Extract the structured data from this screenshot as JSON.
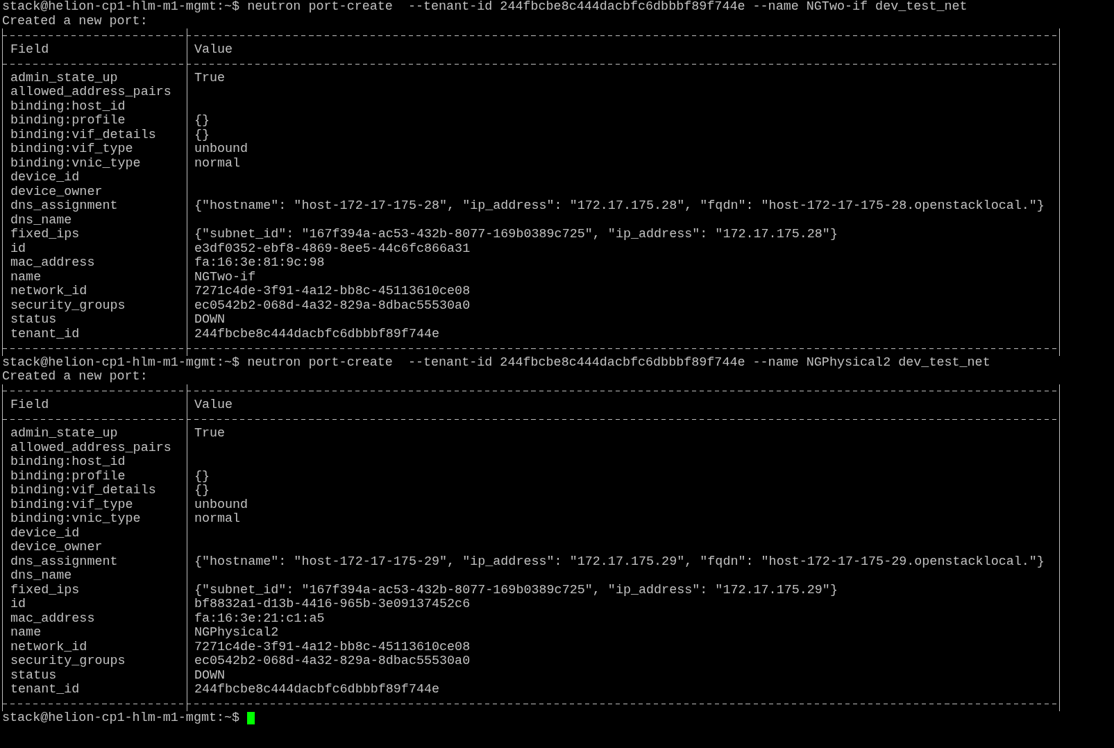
{
  "terminal": {
    "blocks": [
      {
        "prompt": "stack@helion-cp1-hlm-m1-mgmt:~$",
        "command": "neutron port-create  --tenant-id 244fbcbe8c444dacbfc6dbbbf89f744e --name NGTwo-if dev_test_net",
        "output": "Created a new port:",
        "table": {
          "columns": [
            "Field",
            "Value"
          ],
          "rows": [
            {
              "field": "admin_state_up",
              "value": "True"
            },
            {
              "field": "allowed_address_pairs"
            },
            {
              "field": "binding:host_id"
            },
            {
              "field": "binding:profile",
              "value": "{}"
            },
            {
              "field": "binding:vif_details",
              "value": "{}"
            },
            {
              "field": "binding:vif_type",
              "value": "unbound"
            },
            {
              "field": "binding:vnic_type",
              "value": "normal"
            },
            {
              "field": "device_id"
            },
            {
              "field": "device_owner"
            },
            {
              "field": "dns_assignment",
              "value": "{\"hostname\": \"host-172-17-175-28\", \"ip_address\": \"172.17.175.28\", \"fqdn\": \"host-172-17-175-28.openstacklocal.\"}"
            },
            {
              "field": "dns_name"
            },
            {
              "field": "fixed_ips",
              "value": "{\"subnet_id\": \"167f394a-ac53-432b-8077-169b0389c725\", \"ip_address\": \"172.17.175.28\"}"
            },
            {
              "field": "id",
              "value": "e3df0352-ebf8-4869-8ee5-44c6fc866a31"
            },
            {
              "field": "mac_address",
              "value": "fa:16:3e:81:9c:98"
            },
            {
              "field": "name",
              "value": "NGTwo-if"
            },
            {
              "field": "network_id",
              "value": "7271c4de-3f91-4a12-bb8c-45113610ce08"
            },
            {
              "field": "security_groups",
              "value": "ec0542b2-068d-4a32-829a-8dbac55530a0"
            },
            {
              "field": "status",
              "value": "DOWN"
            },
            {
              "field": "tenant_id",
              "value": "244fbcbe8c444dacbfc6dbbbf89f744e"
            }
          ]
        }
      },
      {
        "prompt": "stack@helion-cp1-hlm-m1-mgmt:~$",
        "command": "neutron port-create  --tenant-id 244fbcbe8c444dacbfc6dbbbf89f744e --name NGPhysical2 dev_test_net",
        "output": "Created a new port:",
        "table": {
          "columns": [
            "Field",
            "Value"
          ],
          "rows": [
            {
              "field": "admin_state_up",
              "value": "True"
            },
            {
              "field": "allowed_address_pairs"
            },
            {
              "field": "binding:host_id"
            },
            {
              "field": "binding:profile",
              "value": "{}"
            },
            {
              "field": "binding:vif_details",
              "value": "{}"
            },
            {
              "field": "binding:vif_type",
              "value": "unbound"
            },
            {
              "field": "binding:vnic_type",
              "value": "normal"
            },
            {
              "field": "device_id"
            },
            {
              "field": "device_owner"
            },
            {
              "field": "dns_assignment",
              "value": "{\"hostname\": \"host-172-17-175-29\", \"ip_address\": \"172.17.175.29\", \"fqdn\": \"host-172-17-175-29.openstacklocal.\"}"
            },
            {
              "field": "dns_name"
            },
            {
              "field": "fixed_ips",
              "value": "{\"subnet_id\": \"167f394a-ac53-432b-8077-169b0389c725\", \"ip_address\": \"172.17.175.29\"}"
            },
            {
              "field": "id",
              "value": "bf8832a1-d13b-4416-965b-3e09137452c6"
            },
            {
              "field": "mac_address",
              "value": "fa:16:3e:21:c1:a5"
            },
            {
              "field": "name",
              "value": "NGPhysical2"
            },
            {
              "field": "network_id",
              "value": "7271c4de-3f91-4a12-bb8c-45113610ce08"
            },
            {
              "field": "security_groups",
              "value": "ec0542b2-068d-4a32-829a-8dbac55530a0"
            },
            {
              "field": "status",
              "value": "DOWN"
            },
            {
              "field": "tenant_id",
              "value": "244fbcbe8c444dacbfc6dbbbf89f744e"
            }
          ]
        }
      }
    ],
    "final_prompt": "stack@helion-cp1-hlm-m1-mgmt:~$"
  }
}
